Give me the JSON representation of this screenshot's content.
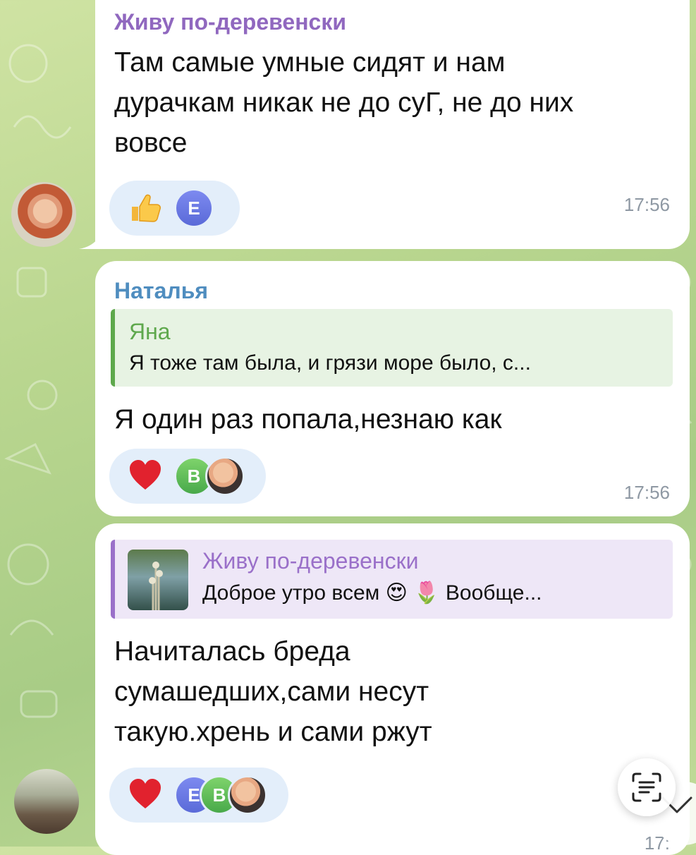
{
  "messages": [
    {
      "sender": "Живу по-деревенски",
      "text": "Там самые умные сидят и нам\nдурачкам никак не до суГ, не до них\nвовсе",
      "reactions": [
        {
          "emoji": "thumbs-up-icon"
        },
        {
          "user_initial": "Е"
        }
      ],
      "time": "17:56"
    },
    {
      "sender": "Наталья",
      "reply": {
        "author": "Яна",
        "text": "Я тоже там была, и грязи море было, с..."
      },
      "text": "Я один раз попала,незнаю как",
      "reactions": [
        {
          "emoji": "red-heart-icon"
        },
        {
          "user_initial": "В"
        },
        {
          "user_avatar": "photo"
        }
      ],
      "time": "17:56"
    },
    {
      "reply": {
        "author": "Живу по-деревенски",
        "text": "Доброе утро всем 😍 🌷 Вообще..."
      },
      "text": "Начиталась бреда\nсумашедших,сами несут\nтакую.хрень и сами ржут",
      "reactions": [
        {
          "emoji": "red-heart-icon"
        },
        {
          "user_initial": "Е"
        },
        {
          "user_initial": "В"
        },
        {
          "user_avatar": "photo"
        }
      ],
      "time": "17:"
    }
  ],
  "colors": {
    "sender_purple": "#9068bf",
    "sender_blue": "#4f8dbf",
    "reply_green": "#5ea84c",
    "reaction_bg": "#e3eefa",
    "time_gray": "#8e98a3"
  }
}
